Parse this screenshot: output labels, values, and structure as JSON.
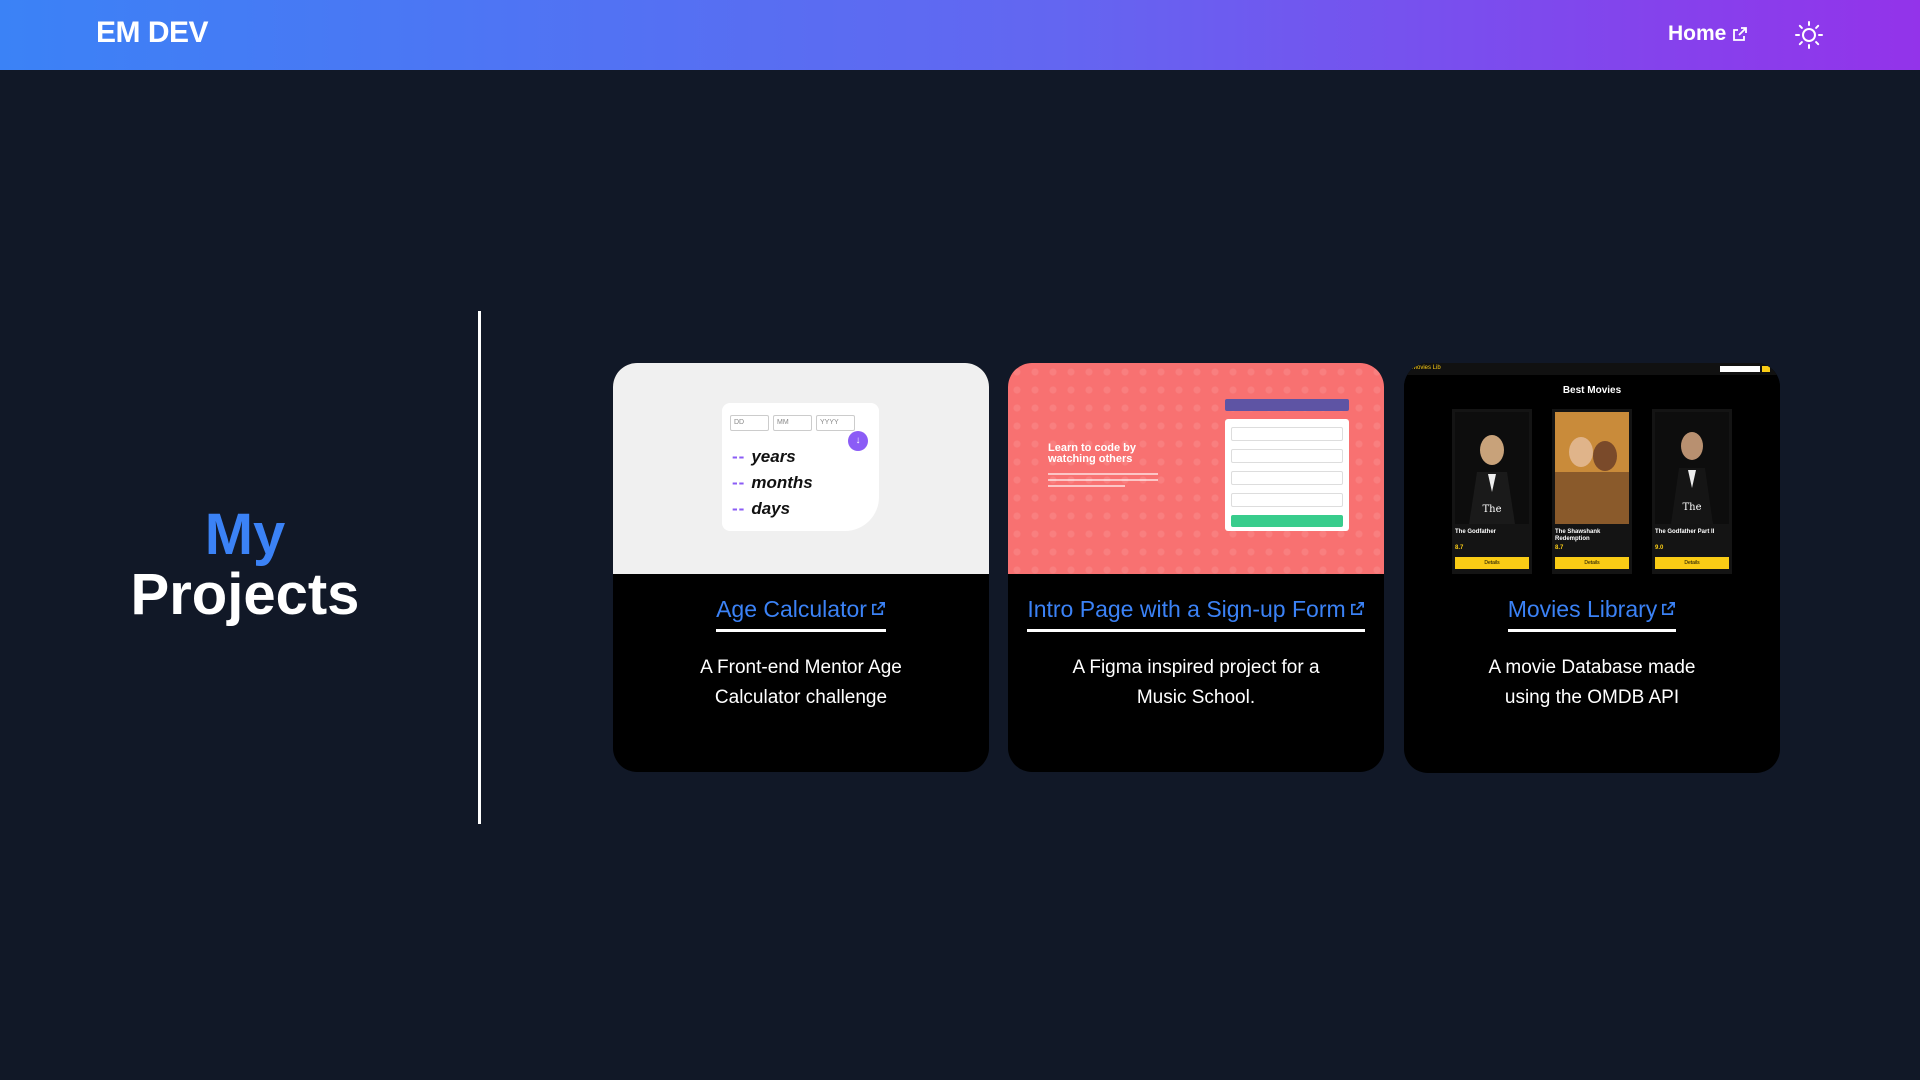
{
  "header": {
    "brand": "EM DEV",
    "nav_home": "Home",
    "theme_icon": "sun-icon",
    "external_icon": "external-link-icon"
  },
  "hero": {
    "title_line1": "My",
    "title_line2": "Projects"
  },
  "colors": {
    "accent": "#3b82f6",
    "background": "#111827",
    "header_gradient": [
      "#3b82f6",
      "#9333ea"
    ]
  },
  "projects": [
    {
      "title": "Age Calculator",
      "description": "A Front-end Mentor Age Calculator challenge",
      "preview": {
        "inputs": [
          "DD",
          "MM",
          "YYYY"
        ],
        "rows": [
          "years",
          "months",
          "days"
        ],
        "dash": "--"
      }
    },
    {
      "title": "Intro Page with a Sign-up Form",
      "description": "A Figma inspired project for a Music School.",
      "preview": {
        "heading": "Learn to code by watching others"
      }
    },
    {
      "title": "Movies Library",
      "description": "A movie Database made using the OMDB API",
      "preview": {
        "app_name": "Movies Lib",
        "heading": "Best Movies",
        "movies": [
          {
            "title": "The Godfather",
            "rating": "8.7",
            "button": "Details"
          },
          {
            "title": "The Shawshank Redemption",
            "rating": "8.7",
            "button": "Details"
          },
          {
            "title": "The Godfather Part II",
            "rating": "9.0",
            "button": "Details"
          }
        ]
      }
    }
  ]
}
